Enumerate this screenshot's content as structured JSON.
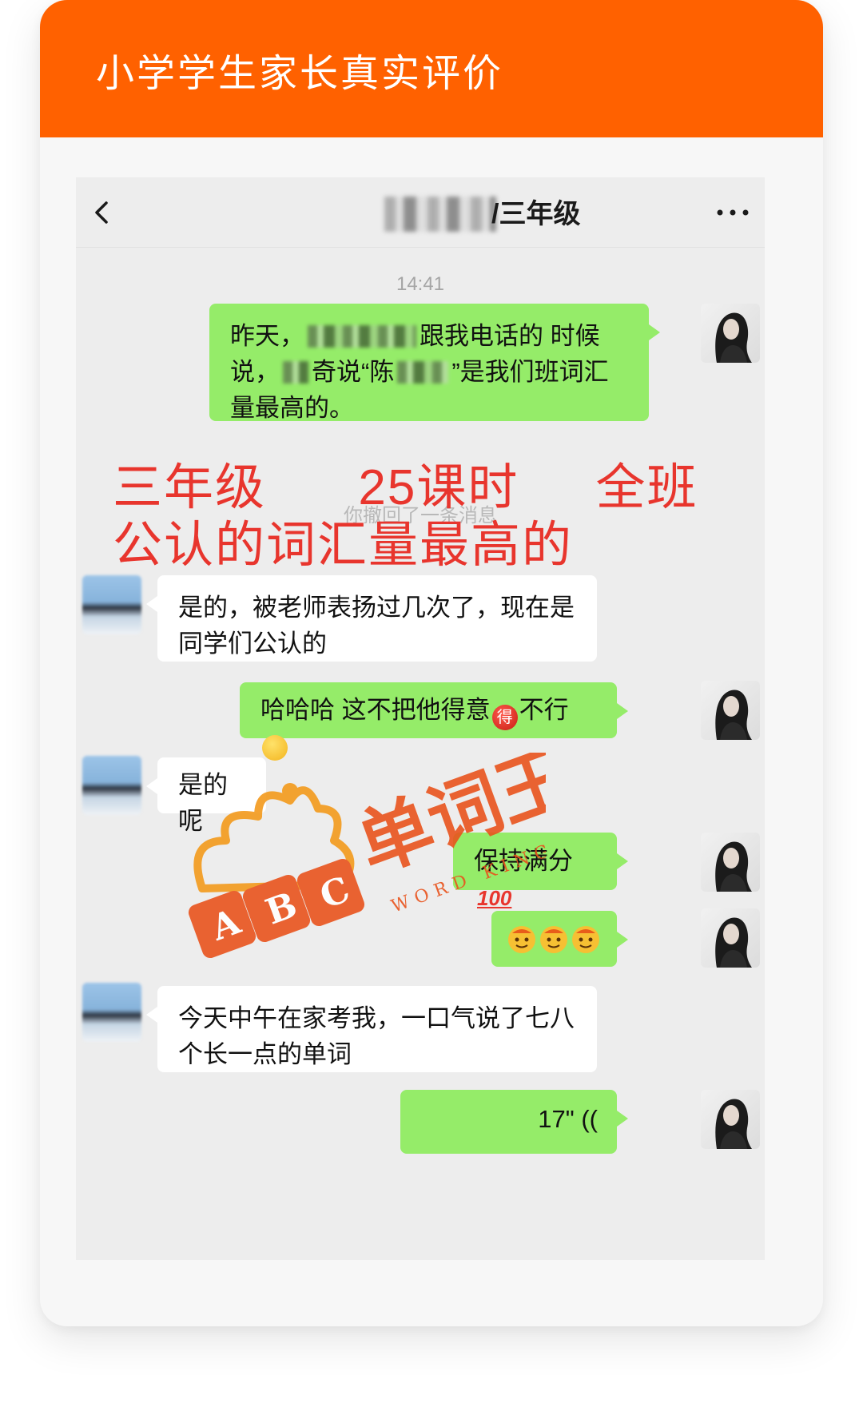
{
  "page": {
    "title": "小学学生家长真实评价"
  },
  "chat": {
    "back_icon": "chevron-left-icon",
    "name": "/三年级",
    "more_icon": "more-dots-icon",
    "timestamp": "14:41",
    "system_message": "你撤回了一条消息",
    "messages": [
      {
        "side": "self",
        "part1": "昨天，",
        "part2": "跟我电话的 时候说，",
        "part3": "奇说“陈",
        "part4": "”是我们班词汇量最高的。"
      },
      {
        "side": "other",
        "text": "是的，被老师表扬过几次了，现在是同学们公认的"
      },
      {
        "side": "self",
        "text": "哈哈哈 这不把他得意",
        "emoji_char": "得",
        "text2": "不行"
      },
      {
        "side": "other",
        "text": "是的呢"
      },
      {
        "side": "self",
        "text": "保持满分",
        "emoji_label": "100"
      },
      {
        "side": "self",
        "text": ""
      },
      {
        "side": "other",
        "text": "今天中午在家考我，一口气说了七八个长一点的单词"
      },
      {
        "side": "self",
        "text": "17\" (("
      }
    ]
  },
  "overlay": {
    "line1": "三年级      25课时     全班",
    "line2": "公认的词汇量最高的"
  },
  "watermark": {
    "brand": "单词王",
    "sub": "WORD KING",
    "abc": [
      "A",
      "B",
      "C"
    ],
    "registered": "R"
  },
  "colors": {
    "header_orange": "#ff6100",
    "bubble_green": "#95ec69",
    "chat_bg": "#ededed",
    "overlay_red": "#e8352d"
  }
}
